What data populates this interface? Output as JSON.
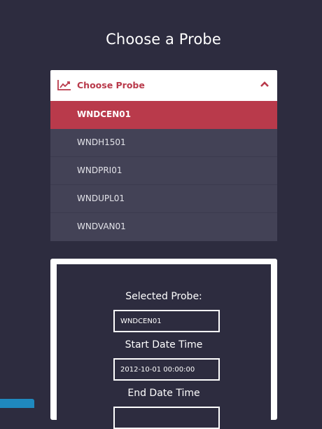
{
  "page": {
    "title": "Choose a Probe"
  },
  "dropdown": {
    "label": "Choose Probe",
    "icon": "line-chart-icon",
    "toggle_icon": "chevron-up-icon",
    "accent_color": "#b93a4b",
    "items": [
      {
        "label": "WNDCEN01",
        "selected": true
      },
      {
        "label": "WNDH1501",
        "selected": false
      },
      {
        "label": "WNDPRI01",
        "selected": false
      },
      {
        "label": "WNDUPL01",
        "selected": false
      },
      {
        "label": "WNDVAN01",
        "selected": false
      }
    ]
  },
  "form": {
    "selected_probe_label": "Selected Probe:",
    "selected_probe_value": "WNDCEN01",
    "start_label": "Start Date Time",
    "start_value": "2012-10-01 00:00:00",
    "end_label": "End Date Time",
    "end_value": ""
  },
  "colors": {
    "background": "#2d2c3f",
    "list_background": "#434256",
    "selected": "#b93a4b",
    "corner_tab": "#1f89be"
  }
}
